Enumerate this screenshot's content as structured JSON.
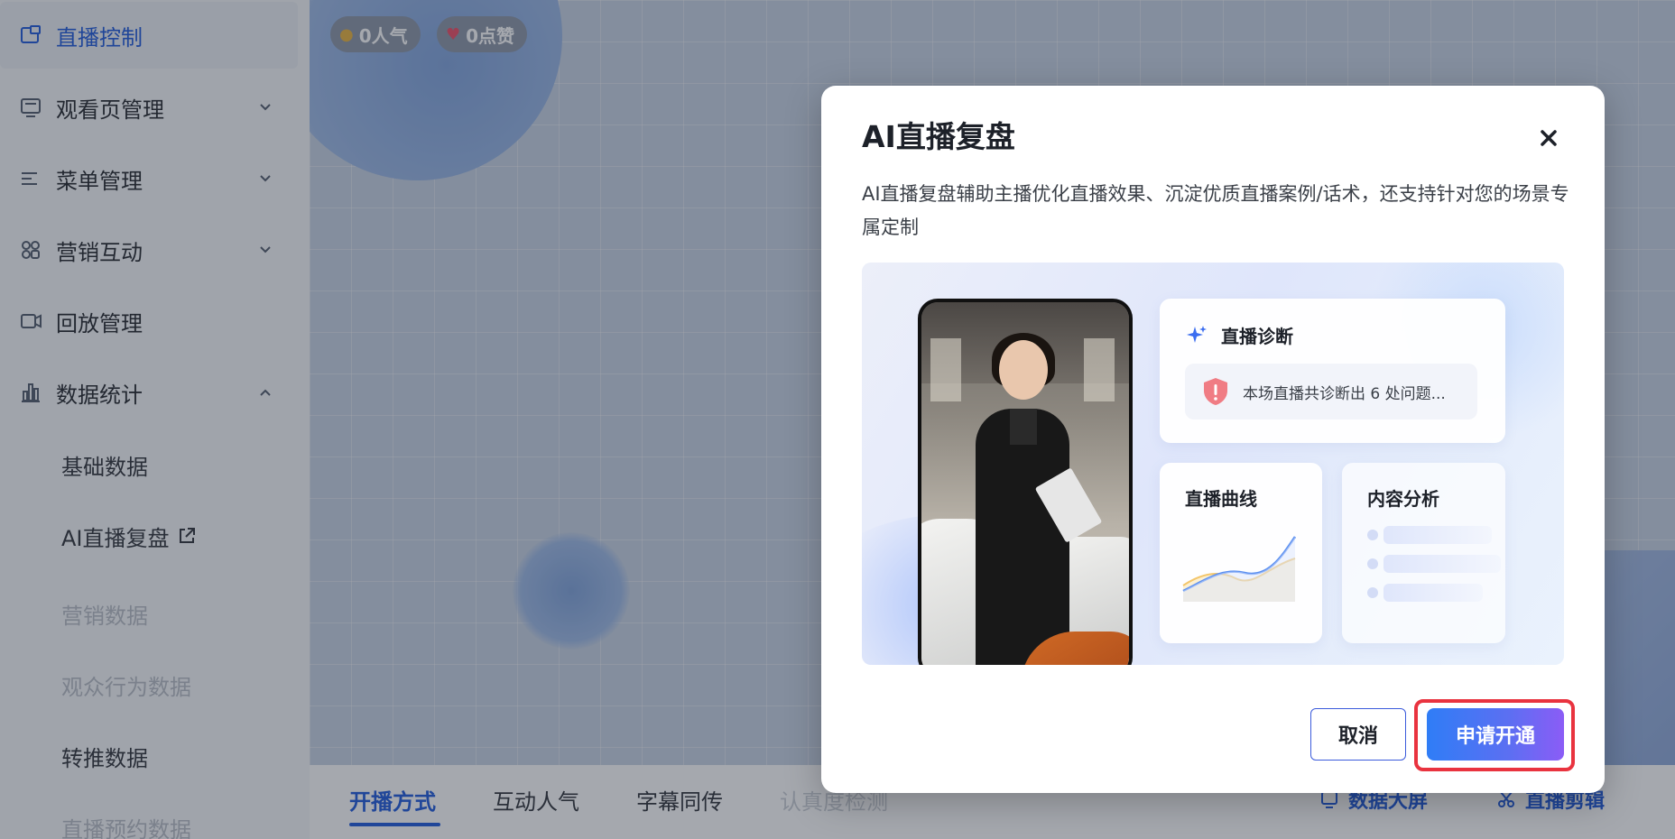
{
  "sidebar": {
    "items": [
      {
        "label": "直播控制",
        "icon": "broadcast-control-icon",
        "active": true
      },
      {
        "label": "观看页管理",
        "icon": "watch-page-icon",
        "expandable": true
      },
      {
        "label": "菜单管理",
        "icon": "menu-icon",
        "expandable": true
      },
      {
        "label": "营销互动",
        "icon": "marketing-icon",
        "expandable": true
      },
      {
        "label": "回放管理",
        "icon": "replay-icon"
      },
      {
        "label": "数据统计",
        "icon": "statistics-icon",
        "expanded": true
      }
    ],
    "sub_items": [
      {
        "label": "基础数据"
      },
      {
        "label": "AI直播复盘",
        "icon": "external-link-icon"
      },
      {
        "label": "营销数据"
      },
      {
        "label": "观众行为数据"
      },
      {
        "label": "转推数据"
      },
      {
        "label": "直播预约数据"
      }
    ]
  },
  "stats": {
    "popularity": "0人气",
    "likes": "0点赞"
  },
  "bottom_tabs": [
    {
      "label": "开播方式",
      "active": true
    },
    {
      "label": "互动人气"
    },
    {
      "label": "字幕同传"
    },
    {
      "label": "认真度检测"
    }
  ],
  "bottom_actions": {
    "data_screen": "数据大屏",
    "live_clip": "直播剪辑"
  },
  "modal": {
    "title": "AI直播复盘",
    "description": "AI直播复盘辅助主播优化直播效果、沉淀优质直播案例/话术，还支持针对您的场景专属定制",
    "banner": {
      "diagnosis_title": "直播诊断",
      "diagnosis_text": "本场直播共诊断出 6 处问题...",
      "curve_title": "直播曲线",
      "analysis_title": "内容分析"
    },
    "cancel_label": "取消",
    "apply_label": "申请开通"
  },
  "colors": {
    "accent": "#1a56db",
    "highlight_border": "#e9333f"
  }
}
